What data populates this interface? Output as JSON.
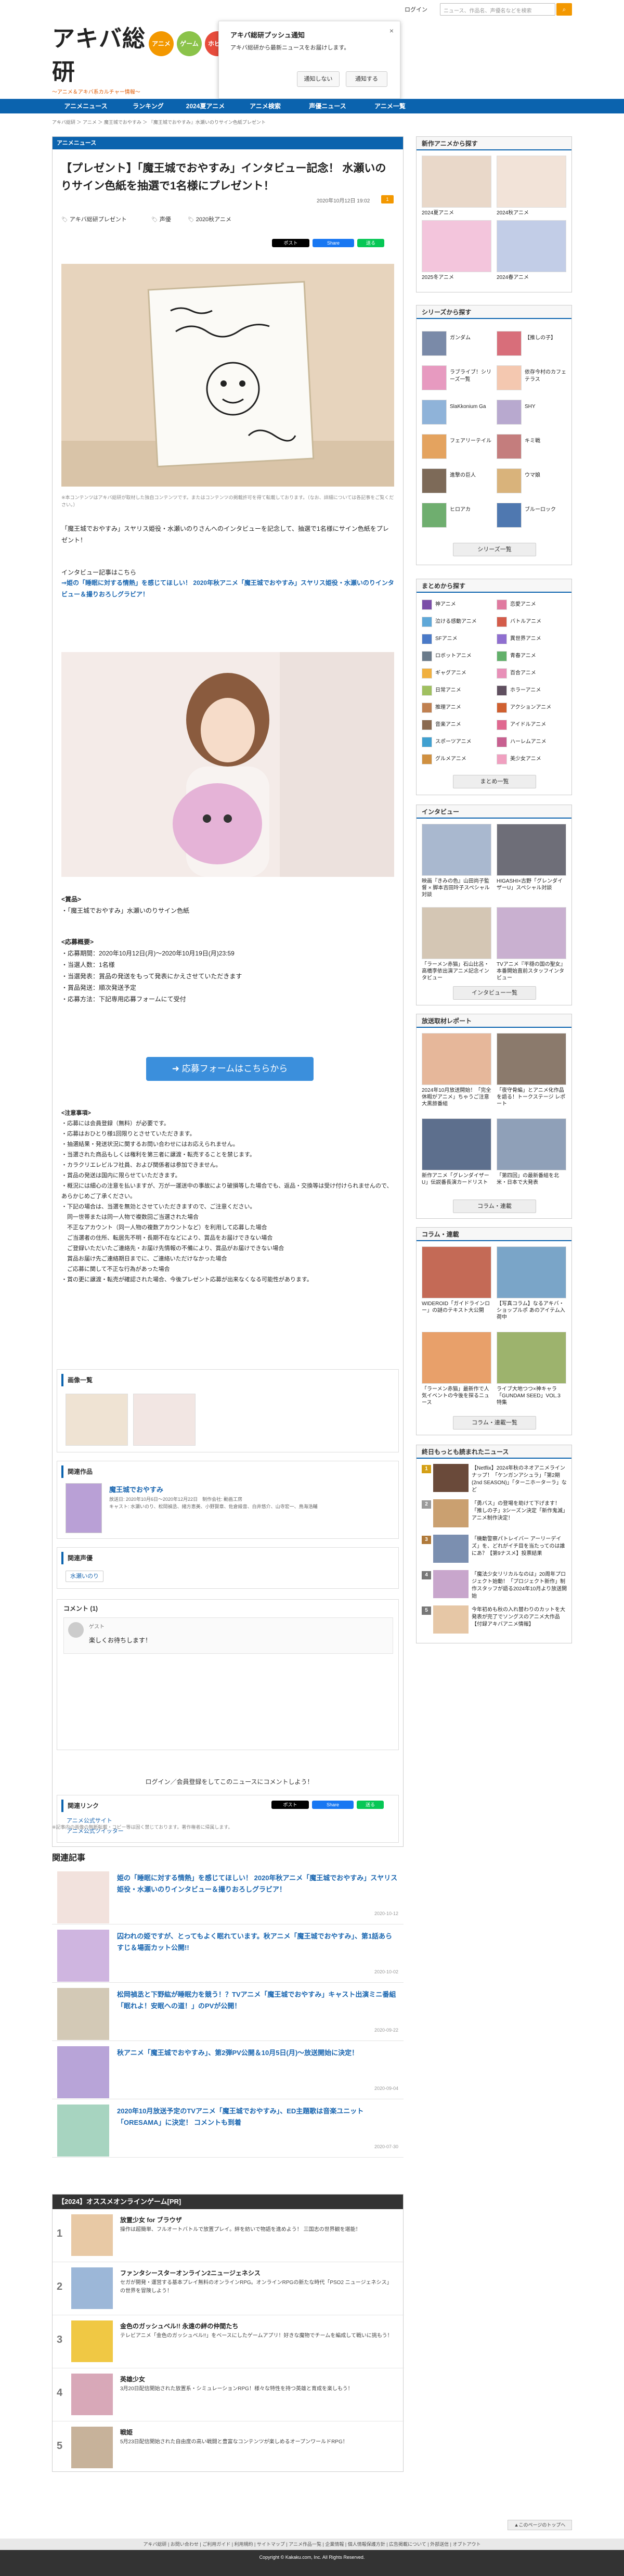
{
  "header": {
    "logo_main": "アキバ総研",
    "logo_sub": "〜アニメ＆アキバ系カルチャー情報〜",
    "circles": [
      "アニメ",
      "ゲーム",
      "ホビー"
    ],
    "login": "ログイン",
    "search_placeholder": "ニュース、作品名、声優名などを検索",
    "search_icon": "search-icon"
  },
  "push": {
    "title": "アキバ総研プッシュ通知",
    "message": "アキバ総研から最新ニュースをお届けします。",
    "deny": "通知しない",
    "allow": "通知する",
    "close": "×"
  },
  "nav": [
    "アニメニュース",
    "ランキング",
    "2024夏アニメ",
    "アニメ検索",
    "声優ニュース",
    "アニメ一覧"
  ],
  "breadcrumb": "アキバ総研 ＞ アニメ ＞ 魔王城でおやすみ ＞ 『魔王城でおやすみ』水瀬いのりサイン色紙プレゼント",
  "article": {
    "section": "アニメニュース",
    "title": "【プレゼント】「魔王城でおやすみ」インタビュー記念！ 水瀬いのりサイン色紙を抽選で1名様にプレゼント！",
    "date": "2020年10月12日 19:02",
    "comments_count": "1",
    "tags": [
      "アキバ総研プレゼント",
      "声優",
      "2020秋アニメ"
    ],
    "share": [
      "ポスト",
      "Share",
      "送る"
    ],
    "caption": "※本コンテンツはアキバ総研が取材した独自コンテンツです。またはコンテンツの掲載許可を得て転載しております。（なお、詳細については各記事をご覧ください。）",
    "intro": "「魔王城でおやすみ」スヤリス姫役・水瀬いのりさんへのインタビューを記念して、抽選で1名様にサイン色紙をプレゼント！",
    "interview_label": "インタビュー記事はこちら",
    "interview_link": "⇒姫の「睡眠に対する情熱」を感じてほしい！ 2020年秋アニメ「魔王城でおやすみ」スヤリス姫役・水瀬いのりインタビュー＆撮りおろしグラビア！",
    "prize_head": "<賞品>",
    "prize": "・「魔王城でおやすみ」水瀬いのりサイン色紙",
    "apply_head": "<応募概要>",
    "apply_lines": [
      "・応募期間：2020年10月12日(月)〜2020年10月19日(月)23:59",
      "・当選人数：1名様",
      "・当選発表：賞品の発送をもって発表にかえさせていただきます",
      "・賞品発送：順次発送予定",
      "・応募方法：下記専用応募フォームにて受付"
    ],
    "apply_button": "➜ 応募フォームはこちらから",
    "notes_head": "<注意事項>",
    "notes": [
      "・応募には会員登録（無料）が必要です。",
      "・応募はおひとり様1回限りとさせていただきます。",
      "・抽選結果・発送状況に関するお問い合わせにはお応えられません。",
      "・当選された商品もしくは権利を第三者に譲渡・転売することを禁じます。",
      "・カラクリエレビルフ社員、および関係者は参加できません。",
      "・賞品の発送は国内に限らせていただきます。",
      "・概況には細心の注意を払いますが、万が一運送中の事故により破損等した場合でも、返品・交換等は受け付けられませんので、あらかじめご了承ください。",
      "・下記の場合は、当選を無効とさせていただきますので、ご注意ください。",
      "　同一世帯または同一人物で複数回ご当選された場合",
      "　不正なアカウント（同一人物の複数アカウントなど）を利用して応募した場合",
      "　ご当選者の住所、転居先不明・長期不在などにより、賞品をお届けできない場合",
      "　ご登録いただいたご連絡先・お届け先情報の不備により、賞品がお届けできない場合",
      "　賞品お届け先ご連絡期日までに、ご連絡いただけなかった場合",
      "　ご応募に関して不正な行為があった場合",
      "・賞の更に譲渡・転売が確認された場合、今後プレゼント応募が出来なくなる可能性があります。"
    ],
    "images_head": "画像一覧",
    "work_head": "関連作品",
    "work_title": "魔王城でおやすみ",
    "work_meta": "放送日: 2020年10月6日〜2020年12月22日　制作会社: 動画工房\nキャスト: 水瀬いのり、松岡禎丞、緒方恵美、小野賢章、佐倉綾音、白井悠介、山寺宏一、鳥海浩輔",
    "seiyu_head": "関連声優",
    "seiyu": "水瀬いのり",
    "comment_link": "ログイン／会員登録をしてこのニュースにコメントしよう！",
    "comment_head": "コメント (1)",
    "comment_user": "ゲスト",
    "comment_text": "楽しくお待ちします！",
    "links_head": "関連リンク",
    "links": [
      "アニメ公式サイト",
      "アニメ公式ツイッター"
    ],
    "copyright": "※記事内の画像の無断転載・コピー等は固く禁じております。著作権者に帰属します。"
  },
  "related": {
    "head": "関連記事",
    "items": [
      {
        "title": "姫の「睡眠に対する情熱」を感じてほしい！ 2020年秋アニメ「魔王城でおやすみ」スヤリス姫役・水瀬いのりインタビュー＆撮りおろしグラビア！",
        "date": "2020-10-12"
      },
      {
        "title": "囚われの姫ですが、とってもよく眠れています。秋アニメ「魔王城でおやすみ」、第1話あらすじ＆場面カット公開!!",
        "date": "2020-10-02"
      },
      {
        "title": "松岡禎丞と下野紘が睡眠力を競う！？TVアニメ「魔王城でおやすみ」キャスト出演ミニ番組「眠れよ！安眠への道！」のPVが公開！",
        "date": "2020-09-22"
      },
      {
        "title": "秋アニメ「魔王城でおやすみ」、第2弾PV公開＆10月5日(月)〜放送開始に決定！",
        "date": "2020-09-04"
      },
      {
        "title": "2020年10月放送予定のTVアニメ「魔王城でおやすみ」、ED主題歌は音楽ユニット「ORESAMA」に決定！ コメントも到着",
        "date": "2020-07-30"
      }
    ]
  },
  "games": {
    "head": "【2024】オススメオンラインゲーム[PR]",
    "items": [
      {
        "rank": "1",
        "title": "放置少女 for ブラウザ",
        "desc": "操作は超簡単、フルオートバトルで放置プレイ。絆を紡いで物語を進めよう！ 三国志の世界観を堪能！"
      },
      {
        "rank": "2",
        "title": "ファンタシースターオンライン2ニュージェネシス",
        "desc": "セガが開発・運営する基本プレイ無料のオンラインRPG。オンラインRPGの新たな時代「PSO2 ニュージェネシス」の世界を冒険しよう！"
      },
      {
        "rank": "3",
        "title": "金色のガッシュベル!! 永遠の絆の仲間たち",
        "desc": "テレビアニメ「金色のガッシュベル!!」をベースにしたゲームアプリ！好きな魔物でチームを編成して戦いに挑もう！"
      },
      {
        "rank": "4",
        "title": "英雄少女",
        "desc": "3月20日配信開始された放置系・シミュレーションRPG！様々な特性を持つ英雄と育成を楽しもう！"
      },
      {
        "rank": "5",
        "title": "戦姫",
        "desc": "5月23日配信開始された自由度の高い戦闘と豊富なコンテンツが楽しめるオープンワールドRPG！"
      }
    ]
  },
  "sidebar": {
    "shinsaku": {
      "head": "新作アニメから探す",
      "items": [
        "2024夏アニメ",
        "2024秋アニメ",
        "2025冬アニメ",
        "2024春アニメ"
      ]
    },
    "series": {
      "head": "シリーズから探す",
      "items": [
        "ガンダム",
        "【推しの子】",
        "ラブライブ！シリーズ一覧",
        "依存今村のカフェテラス",
        "SlaKkonium Ga",
        "SHY",
        "フェアリーテイル",
        "キミ戦",
        "進撃の巨人",
        "ウマ娘",
        "ヒロアカ",
        "ブルーロック"
      ],
      "more": "シリーズ一覧"
    },
    "matome": {
      "head": "まとめから探す",
      "items": [
        "神アニメ",
        "恋愛アニメ",
        "泣ける感動アニメ",
        "バトルアニメ",
        "SFアニメ",
        "異世界アニメ",
        "ロボットアニメ",
        "青春アニメ",
        "ギャグアニメ",
        "百合アニメ",
        "日常アニメ",
        "ホラーアニメ",
        "推理アニメ",
        "アクションアニメ",
        "音楽アニメ",
        "アイドルアニメ",
        "スポーツアニメ",
        "ハーレムアニメ",
        "グルメアニメ",
        "美少女アニメ"
      ],
      "more": "まとめ一覧"
    },
    "interview": {
      "head": "インタビュー",
      "items": [
        "映画『きみの色』山田尚子監督 × 脚本吉田玲子スペシャル対談",
        "HIGASHI×古野「グレンダイザーU」スペシャル対談",
        "「ラーメン赤猫」石山比呂・高橋李依出演アニメ記念インタビュー",
        "TVアニメ『平穏の国の聖女』本番開始直前スタッフインタビュー"
      ],
      "more": "インタビュー一覧"
    },
    "report": {
      "head": "放送取材レポート",
      "items": [
        "2024年10月放送開始！「完全休暇がアニメ」ちゃうご注意 大黒旅番組",
        "「夜守骨編」とアニメ化作品を語る！トークステージ レポート",
        "新作アニメ「グレンダイザーU」伝説番長演カードリスト",
        "「第四回」の最新番組を北米・日本で大発表"
      ],
      "more": "コラム・連載"
    },
    "column": {
      "head": "コラム・連載",
      "items": [
        "WIDEROID「ガイドラインロー」の謎のテキスト大公開",
        "【写真コラム】なるアキバ・ショップルポ あのアイテム入荷中",
        "「ラーメン赤猫」最新作で人気イベントの今後を探るニュース",
        "ライブ大地つつ×神キャラ「GUNDAM SEED」VOL.3 特集"
      ],
      "more": "コラム・連載一覧"
    },
    "ranking": {
      "head": "終日もっとも読まれたニュース",
      "items": [
        {
          "rank": "1",
          "title": "【Netflix】2024年秋のネオアニメラインナップ！「ケンガンアシュラ」「第2期 (2nd SEASON)」「ターニホーターラ」など"
        },
        {
          "rank": "2",
          "title": "「勇バス」の登場を助けて下げます！「推しの子」3シーズン決定「新作鬼滅」アニメ制作決定！"
        },
        {
          "rank": "3",
          "title": "「機動警察パトレイバー アーリーデイズ」を、どれがイチ目を当たってのは誰にあ？【第9ナスメ】投票結果"
        },
        {
          "rank": "4",
          "title": "「魔法少女リリカルなのは」20周年プロジェクト始動！「プロジェクト新作」制作スタッフが語る2024年10月より放送開始"
        },
        {
          "rank": "5",
          "title": "今年初めも秋の入れ替わりのカットを大発表が完了でソングスのアニメ大作品【付録アキバアニメ情報】"
        }
      ]
    }
  },
  "footer": {
    "links": "アキバ総研 | お問い合わせ | ご利用ガイド | 利用規約 | サイトマップ | アニメ作品一覧 | 企業情報 | 個人情報保護方針 | 広告掲載について | 外部送信 | オプトアウト",
    "copyright": "Copyright © Kakaku.com, Inc. All Rights Reserved.",
    "pagetop": "▲このページのトップへ"
  },
  "colors": {
    "brand": "#0b63ae",
    "accent": "#f39800",
    "link": "#1a66b0"
  }
}
